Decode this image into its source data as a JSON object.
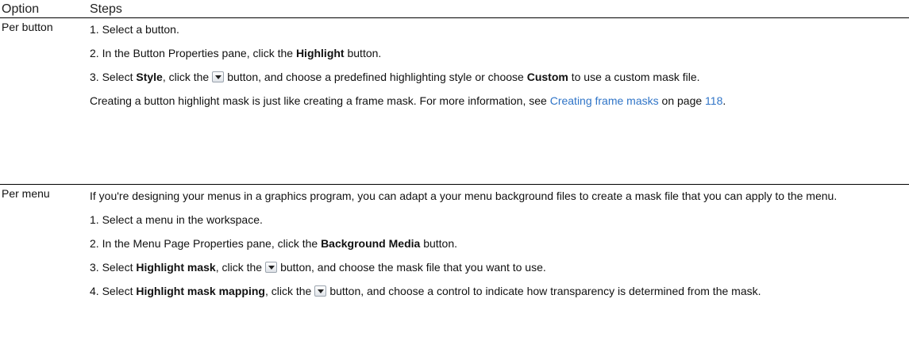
{
  "header": {
    "option": "Option",
    "steps": "Steps"
  },
  "rows": [
    {
      "option": "Per button",
      "steps": {
        "s1": "1. Select a button.",
        "s2_pre": "2. In the Button Properties pane, click the ",
        "s2_bold": "Highlight",
        "s2_post": " button.",
        "s3_pre": "3. Select ",
        "s3_bold1": "Style",
        "s3_mid": ", click the",
        "s3_after_btn": "button, and choose a predefined highlighting style or choose ",
        "s3_bold2": "Custom",
        "s3_post": " to use a custom mask file.",
        "note_pre": "Creating a button highlight mask is just like creating a frame mask. For more information, see ",
        "note_link": "Creating frame masks",
        "note_mid": " on page ",
        "note_page": "118",
        "note_post": "."
      }
    },
    {
      "option": "Per menu",
      "steps": {
        "intro": "If you're designing your menus in a graphics program, you can adapt a your menu background files to create a mask file that you can apply to the menu.",
        "s1": "1. Select a menu in the workspace.",
        "s2_pre": "2. In the Menu Page Properties pane, click the ",
        "s2_bold": "Background Media",
        "s2_post": " button.",
        "s3_pre": "3. Select ",
        "s3_bold": "Highlight mask",
        "s3_mid": ", click the",
        "s3_post": "button, and choose the mask file that you want to use.",
        "s4_pre": "4. Select ",
        "s4_bold": "Highlight mask mapping",
        "s4_mid": ", click the",
        "s4_post": "button, and choose a control to indicate how transparency is determined from the mask."
      }
    }
  ],
  "icons": {
    "dropdown_button": "dropdown-arrow-button-icon"
  },
  "colors": {
    "link": "#2f74c7",
    "rule": "#000000"
  }
}
